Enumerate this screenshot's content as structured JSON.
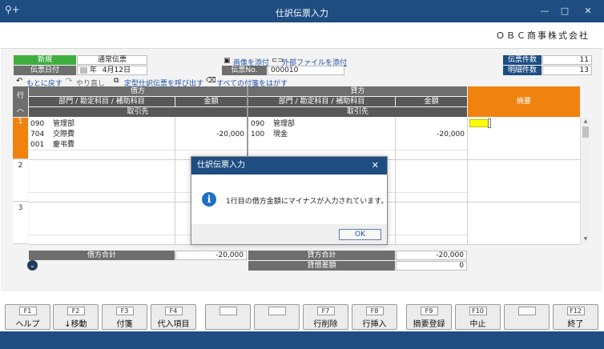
{
  "window": {
    "title": "仕訳伝票入力",
    "minimize": "—",
    "maximize": "□",
    "close": "✕",
    "app_icon": "⚲+"
  },
  "company": "ＯＢＣ商事株式会社",
  "header": {
    "mode": "新規",
    "voucher_type": "通常伝票",
    "date_label": "伝票日付",
    "date_era": "年",
    "date_value": "4月12日",
    "attach_image": "画像を添付",
    "attach_external": "外部ファイルを添付",
    "voucher_no_label": "伝票No.",
    "voucher_no": "000010",
    "voucher_count_label": "伝票件数",
    "voucher_count": "11",
    "detail_count_label": "明細件数",
    "detail_count": "13"
  },
  "toolbar": {
    "undo": "もとに戻す",
    "redo": "やり直し",
    "template": "定型仕訳伝票を呼び出す",
    "remove_tags": "すべての付箋をはがす"
  },
  "grid": {
    "row_label": "行",
    "debit_header": "借方",
    "credit_header": "貸方",
    "dept_account_header": "部門 / 勘定科目 / 補助科目",
    "amount_header": "金額",
    "partner_header": "取引先",
    "summary_header": "摘要",
    "rows": [
      {
        "num": "1",
        "debit_codes": [
          "090",
          "704",
          "001"
        ],
        "debit_names": [
          "管理部",
          "交際費",
          "慶弔費"
        ],
        "debit_amount": "-20,000",
        "credit_codes": [
          "090",
          "100"
        ],
        "credit_names": [
          "管理部",
          "現金"
        ],
        "credit_amount": "-20,000"
      },
      {
        "num": "2"
      },
      {
        "num": "3"
      }
    ]
  },
  "totals": {
    "debit_total_label": "借方合計",
    "debit_total": "-20,000",
    "credit_total_label": "貸方合計",
    "credit_total": "-20,000",
    "difference_label": "貸借差額",
    "difference": "0"
  },
  "dialog": {
    "title": "仕訳伝票入力",
    "message": "1行目の借方金額にマイナスが入力されています。",
    "ok": "OK",
    "close": "✕",
    "icon": "i"
  },
  "fkeys": [
    {
      "key": "F1",
      "label": "ヘルプ"
    },
    {
      "key": "F2",
      "label": "↓移動"
    },
    {
      "key": "F3",
      "label": "付箋"
    },
    {
      "key": "F4",
      "label": "代入項目"
    },
    {
      "key": "",
      "label": ""
    },
    {
      "key": "",
      "label": ""
    },
    {
      "key": "F7",
      "label": "行削除"
    },
    {
      "key": "F8",
      "label": "行挿入"
    },
    {
      "key": "F9",
      "label": "摘要登録"
    },
    {
      "key": "F10",
      "label": "中止"
    },
    {
      "key": "",
      "label": ""
    },
    {
      "key": "F12",
      "label": "終了"
    }
  ],
  "colors": {
    "titlebar": "#1e4d82",
    "summary_header": "#f0830f",
    "mode_badge": "#3fae3f",
    "active_cell": "#ffff00"
  }
}
